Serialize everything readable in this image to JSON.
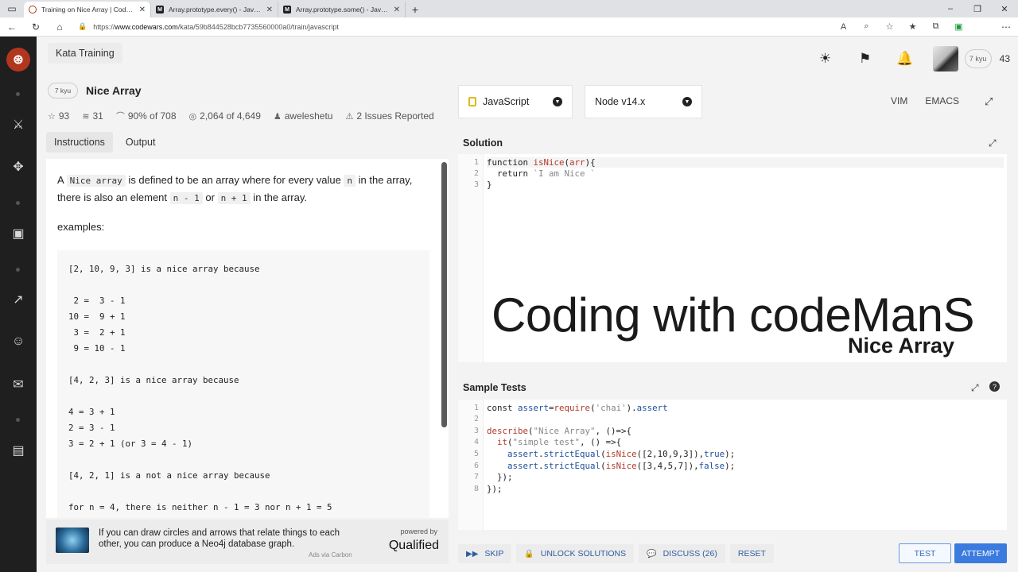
{
  "browser": {
    "tabs": [
      {
        "title": "Training on Nice Array | Codewa",
        "active": true,
        "icon": "codewars-icon"
      },
      {
        "title": "Array.prototype.every() - JavaSc",
        "active": false,
        "icon": "mdn-icon"
      },
      {
        "title": "Array.prototype.some() - JavaSc",
        "active": false,
        "icon": "mdn-icon"
      }
    ],
    "url_prefix": "https://",
    "url_host": "www.codewars.com",
    "url_path": "/kata/59b844528bcb7735560000a0/train/javascript"
  },
  "topbar": {
    "kata_training_label": "Kata Training",
    "rank": "7 kyu",
    "honor": "43"
  },
  "kata": {
    "kyu": "7 kyu",
    "name": "Nice Array",
    "stats": {
      "stars": "93",
      "collections": "31",
      "satisfaction": "90% of 708",
      "completed": "2,064 of 4,649",
      "author": "aweleshetu",
      "issues": "2 Issues Reported"
    }
  },
  "left_tabs": {
    "instructions": "Instructions",
    "output": "Output"
  },
  "description": {
    "p1_a": "A ",
    "p1_code1": "Nice array",
    "p1_b": " is defined to be an array where for every value ",
    "p1_code2": "n",
    "p1_c": " in the array, there is also an element ",
    "p1_code3": "n - 1",
    "p1_d": " or ",
    "p1_code4": "n + 1",
    "p1_e": " in the array.",
    "examples_label": "examples:",
    "examples_code": "[2, 10, 9, 3] is a nice array because\n\n 2 =  3 - 1\n10 =  9 + 1\n 3 =  2 + 1\n 9 = 10 - 1\n\n[4, 2, 3] is a nice array because\n\n4 = 3 + 1\n2 = 3 - 1\n3 = 2 + 1 (or 3 = 4 - 1)\n\n[4, 2, 1] is a not a nice array because\n\nfor n = 4, there is neither n - 1 = 3 nor n + 1 = 5"
  },
  "ad": {
    "text": "If you can draw circles and arrows that relate things to each other, you can produce a Neo4j database graph.",
    "via": "Ads via Carbon",
    "powered_by": "powered by",
    "brand": "Qualified"
  },
  "editor": {
    "language": "JavaScript",
    "version": "Node v14.x",
    "vim": "VIM",
    "emacs": "EMACS",
    "solution_title": "Solution",
    "tests_title": "Sample Tests"
  },
  "solution_lines": [
    {
      "n": "1",
      "code": "function isNice(arr){"
    },
    {
      "n": "2",
      "code": "  return `I am Nice `"
    },
    {
      "n": "3",
      "code": "}"
    }
  ],
  "test_lines": [
    {
      "n": "1",
      "code": "const assert=require('chai').assert"
    },
    {
      "n": "2",
      "code": ""
    },
    {
      "n": "3",
      "code": "describe(\"Nice Array\", ()=>{"
    },
    {
      "n": "4",
      "code": "  it(\"simple test\", () =>{"
    },
    {
      "n": "5",
      "code": "    assert.strictEqual(isNice([2,10,9,3]),true);"
    },
    {
      "n": "6",
      "code": "    assert.strictEqual(isNice([3,4,5,7]),false);"
    },
    {
      "n": "7",
      "code": "  });"
    },
    {
      "n": "8",
      "code": "});"
    }
  ],
  "watermark": {
    "line1": "Coding with codeManS",
    "line2": "Nice Array"
  },
  "actions": {
    "skip": "SKIP",
    "unlock": "UNLOCK SOLUTIONS",
    "discuss": "DISCUSS (26)",
    "reset": "RESET",
    "test": "TEST",
    "attempt": "ATTEMPT"
  },
  "colors": {
    "brand": "#b1361e",
    "accent": "#3b7be0",
    "rail": "#1f1f1f"
  }
}
